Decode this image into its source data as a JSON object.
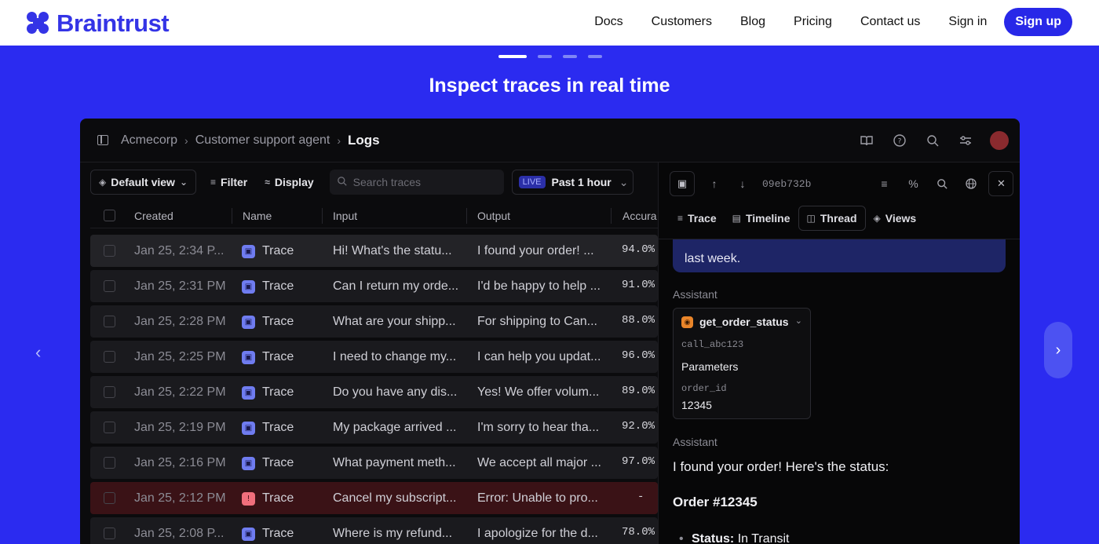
{
  "brand": {
    "name": "Braintrust"
  },
  "nav": {
    "links": [
      "Docs",
      "Customers",
      "Blog",
      "Pricing",
      "Contact us",
      "Sign in"
    ],
    "signup": "Sign up"
  },
  "hero": {
    "title": "Inspect traces in real time"
  },
  "app": {
    "breadcrumb": [
      "Acmecorp",
      "Customer support agent",
      "Logs"
    ],
    "toolbar": {
      "view": "Default view",
      "filter": "Filter",
      "display": "Display",
      "search_placeholder": "Search traces",
      "live": "LIVE",
      "time_range": "Past 1 hour"
    },
    "columns": [
      "Created",
      "Name",
      "Input",
      "Output",
      "Accura"
    ],
    "rows": [
      {
        "created": "Jan 25, 2:34 P...",
        "name": "Trace",
        "input": "Hi! What's the statu...",
        "output": "I found your order! ...",
        "accuracy": "94.0%",
        "error": false
      },
      {
        "created": "Jan 25, 2:31 PM",
        "name": "Trace",
        "input": "Can I return my orde...",
        "output": "I'd be happy to help ...",
        "accuracy": "91.0%",
        "error": false
      },
      {
        "created": "Jan 25, 2:28 PM",
        "name": "Trace",
        "input": "What are your shipp...",
        "output": "For shipping to Can...",
        "accuracy": "88.0%",
        "error": false
      },
      {
        "created": "Jan 25, 2:25 PM",
        "name": "Trace",
        "input": "I need to change my...",
        "output": "I can help you updat...",
        "accuracy": "96.0%",
        "error": false
      },
      {
        "created": "Jan 25, 2:22 PM",
        "name": "Trace",
        "input": "Do you have any dis...",
        "output": "Yes! We offer volum...",
        "accuracy": "89.0%",
        "error": false
      },
      {
        "created": "Jan 25, 2:19 PM",
        "name": "Trace",
        "input": "My package arrived ...",
        "output": "I'm sorry to hear tha...",
        "accuracy": "92.0%",
        "error": false
      },
      {
        "created": "Jan 25, 2:16 PM",
        "name": "Trace",
        "input": "What payment meth...",
        "output": "We accept all major ...",
        "accuracy": "97.0%",
        "error": false
      },
      {
        "created": "Jan 25, 2:12 PM",
        "name": "Trace",
        "input": "Cancel my subscript...",
        "output": "Error: Unable to pro...",
        "accuracy": "-",
        "error": true
      },
      {
        "created": "Jan 25, 2:08 P...",
        "name": "Trace",
        "input": "Where is my refund...",
        "output": "I apologize for the d...",
        "accuracy": "78.0%",
        "error": false
      }
    ],
    "detail": {
      "trace_id": "09eb732b",
      "tabs": [
        "Trace",
        "Timeline",
        "Thread",
        "Views"
      ],
      "active_tab": "Thread",
      "user_tail": "last week.",
      "assistant_label": "Assistant",
      "tool": {
        "name": "get_order_status",
        "call_id": "call_abc123",
        "params_label": "Parameters",
        "param_key": "order_id",
        "param_value": "12345"
      },
      "reply_intro": "I found your order! Here's the status:",
      "order_heading": "Order #12345",
      "status_label": "Status:",
      "status_value": "In Transit"
    }
  },
  "colors": {
    "hero_bg": "#2b2bf0",
    "brand": "#3434e6",
    "app_bg": "#0b0b0d",
    "trace_icon": "#6f7cf0",
    "error_row": "#3a1216",
    "user_bubble": "#1e2566"
  }
}
